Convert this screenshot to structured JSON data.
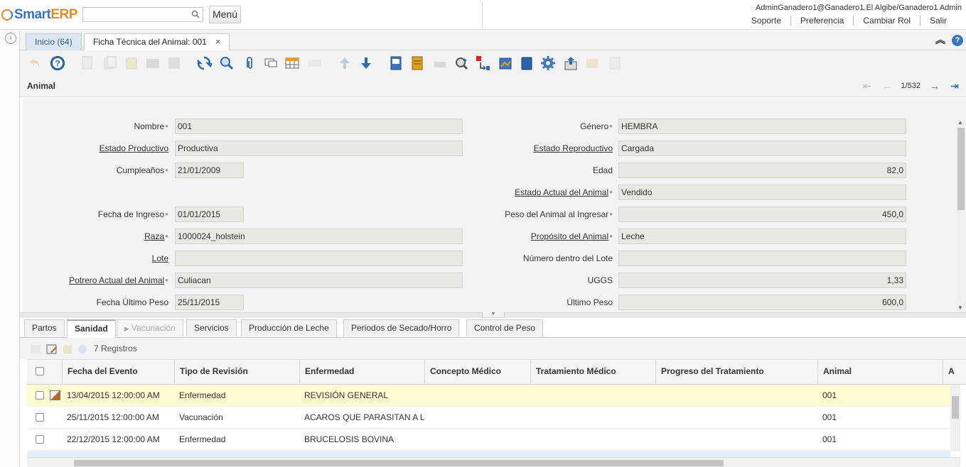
{
  "header": {
    "logo_main": "Smart",
    "logo_accent": "ERP",
    "search_placeholder": "",
    "menu_label": "Menú",
    "user_line": "AdminGanadero1@Ganadero1.El Algibe/Ganadero1 Admin",
    "links": [
      "Soporte",
      "Preferencia",
      "Cambiar Rol",
      "Salir"
    ]
  },
  "window_tabs": {
    "home": "Inicio (64)",
    "active": "Ficha Técnica del Animal: 001",
    "close": "×"
  },
  "record": {
    "title": "Animal",
    "position": "1/532"
  },
  "form": {
    "nombre": {
      "label": "Nombre",
      "value": "001"
    },
    "estado_productivo": {
      "label": "Estado Productivo",
      "value": "Productiva"
    },
    "cumpleanos": {
      "label": "Cumpleaños",
      "value": "21/01/2009"
    },
    "fecha_ingreso": {
      "label": "Fecha de Ingreso",
      "value": "01/01/2015"
    },
    "raza": {
      "label": "Raza",
      "value": "1000024_holstein"
    },
    "lote": {
      "label": "Lote",
      "value": ""
    },
    "potrero": {
      "label": "Potrero Actual del Animal",
      "value": "Culiacan"
    },
    "fecha_ultimo_peso": {
      "label": "Fecha Último Peso",
      "value": "25/11/2015"
    },
    "genero": {
      "label": "Género",
      "value": "HEMBRA"
    },
    "estado_reproductivo": {
      "label": "Estado Reproductivo",
      "value": "Cargada"
    },
    "edad": {
      "label": "Edad",
      "value": "82,0"
    },
    "estado_actual": {
      "label": "Estado Actual del Animal",
      "value": "Vendido"
    },
    "peso_ingresar": {
      "label": "Peso del Animal al Ingresar",
      "value": "450,0"
    },
    "proposito": {
      "label": "Propósito del Animal",
      "value": "Leche"
    },
    "numero_lote": {
      "label": "Número dentro del Lote",
      "value": ""
    },
    "uggs": {
      "label": "UGGS",
      "value": "1,33"
    },
    "ultimo_peso": {
      "label": "Último Peso",
      "value": "600,0"
    }
  },
  "detail_tabs": [
    "Partos",
    "Sanidad",
    "Vacunación",
    "Servicios",
    "Producción de Leche",
    "Periodos de Secado/Horro",
    "Control de Peso"
  ],
  "grid": {
    "count_label": "7 Registros",
    "columns": [
      "Fecha del Evento",
      "Tipo de Revisión",
      "Enfermedad",
      "Concepto Médico",
      "Tratamiento Médico",
      "Progreso del Tratamiento",
      "Animal",
      "A"
    ],
    "rows": [
      {
        "fecha": "13/04/2015 12:00:00 AM",
        "tipo": "Enfermedad",
        "enfermedad": "REVISIÓN GENERAL",
        "animal": "001"
      },
      {
        "fecha": "25/11/2015 12:00:00 AM",
        "tipo": "Vacunación",
        "enfermedad": "ACAROS QUE PARASITAN A L",
        "animal": "001"
      },
      {
        "fecha": "22/12/2015 12:00:00 AM",
        "tipo": "Enfermedad",
        "enfermedad": "BRUCELOSIS BOVINA",
        "animal": "001"
      }
    ]
  },
  "colors": {
    "brand_blue": "#3a76b9",
    "brand_orange": "#e08a2c",
    "selected_row": "#fffbd1",
    "panel_bg": "#f3f3f3"
  }
}
